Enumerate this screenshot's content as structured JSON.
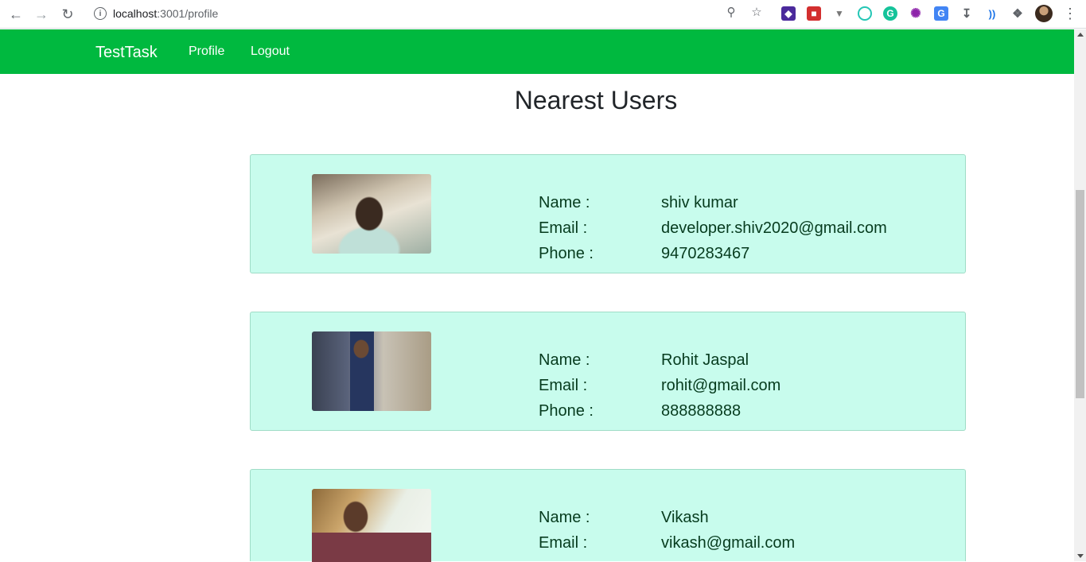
{
  "browser": {
    "url_host": "localhost",
    "url_path": ":3001/profile"
  },
  "navbar": {
    "brand": "TestTask",
    "links": [
      "Profile",
      "Logout"
    ]
  },
  "page": {
    "title": "Nearest Users"
  },
  "labels": {
    "name": "Name :",
    "email": "Email :",
    "phone": "Phone :"
  },
  "users": [
    {
      "name": "shiv kumar",
      "email": "developer.shiv2020@gmail.com",
      "phone": "9470283467"
    },
    {
      "name": "Rohit Jaspal",
      "email": "rohit@gmail.com",
      "phone": "888888888"
    },
    {
      "name": "Vikash",
      "email": "vikash@gmail.com",
      "phone": ""
    }
  ],
  "colors": {
    "navbar": "#00b93f",
    "card_bg": "#c8fced",
    "card_border": "#9fdcc6"
  }
}
